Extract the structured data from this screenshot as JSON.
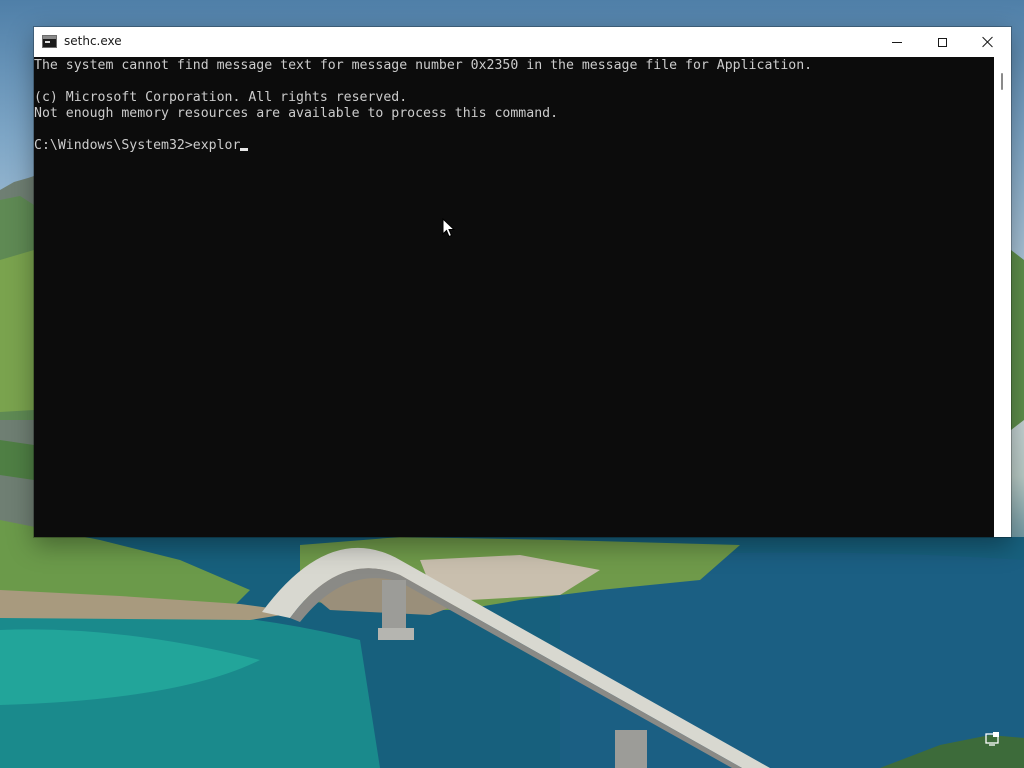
{
  "window": {
    "title": "sethc.exe",
    "icon": "console-icon",
    "controls": {
      "minimize": "minimize-icon",
      "maximize": "maximize-icon",
      "close": "close-icon"
    }
  },
  "console": {
    "lines": [
      "The system cannot find message text for message number 0x2350 in the message file for Application.",
      "",
      "(c) Microsoft Corporation. All rights reserved.",
      "Not enough memory resources are available to process this command.",
      ""
    ],
    "prompt": "C:\\Windows\\System32>",
    "input": "explor"
  },
  "desktop": {
    "wallpaper": "coastal-bridge-landscape",
    "corner_icon": "remote-desktop-icon"
  },
  "colors": {
    "console_bg": "#0c0c0c",
    "console_text": "#cccccc",
    "titlebar_bg": "#ffffff"
  }
}
